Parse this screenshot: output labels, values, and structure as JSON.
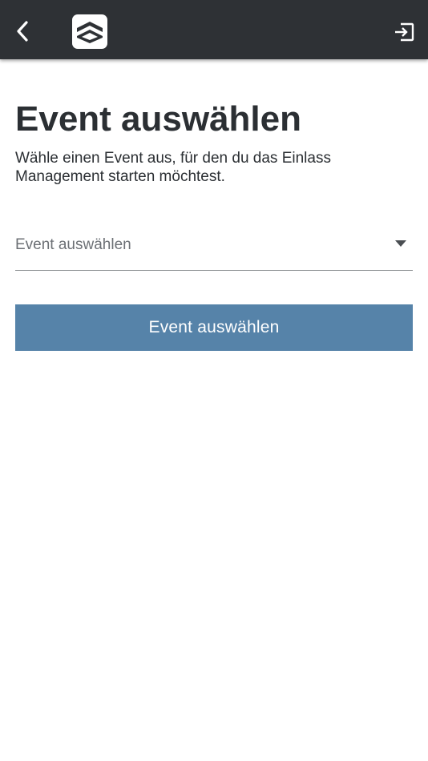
{
  "app_bar": {
    "back_icon": "chevron-left-icon",
    "logo_icon": "app-logo-icon",
    "logout_icon": "logout-icon",
    "background_color": "#2e3135"
  },
  "page": {
    "title": "Event auswählen",
    "description": "Wähle einen Event aus, für den du das Einlass Management starten möchtest."
  },
  "event_select": {
    "placeholder": "Event auswählen",
    "arrow_icon": "caret-down-icon"
  },
  "submit": {
    "label": "Event auswählen",
    "color": "#5683a9"
  }
}
